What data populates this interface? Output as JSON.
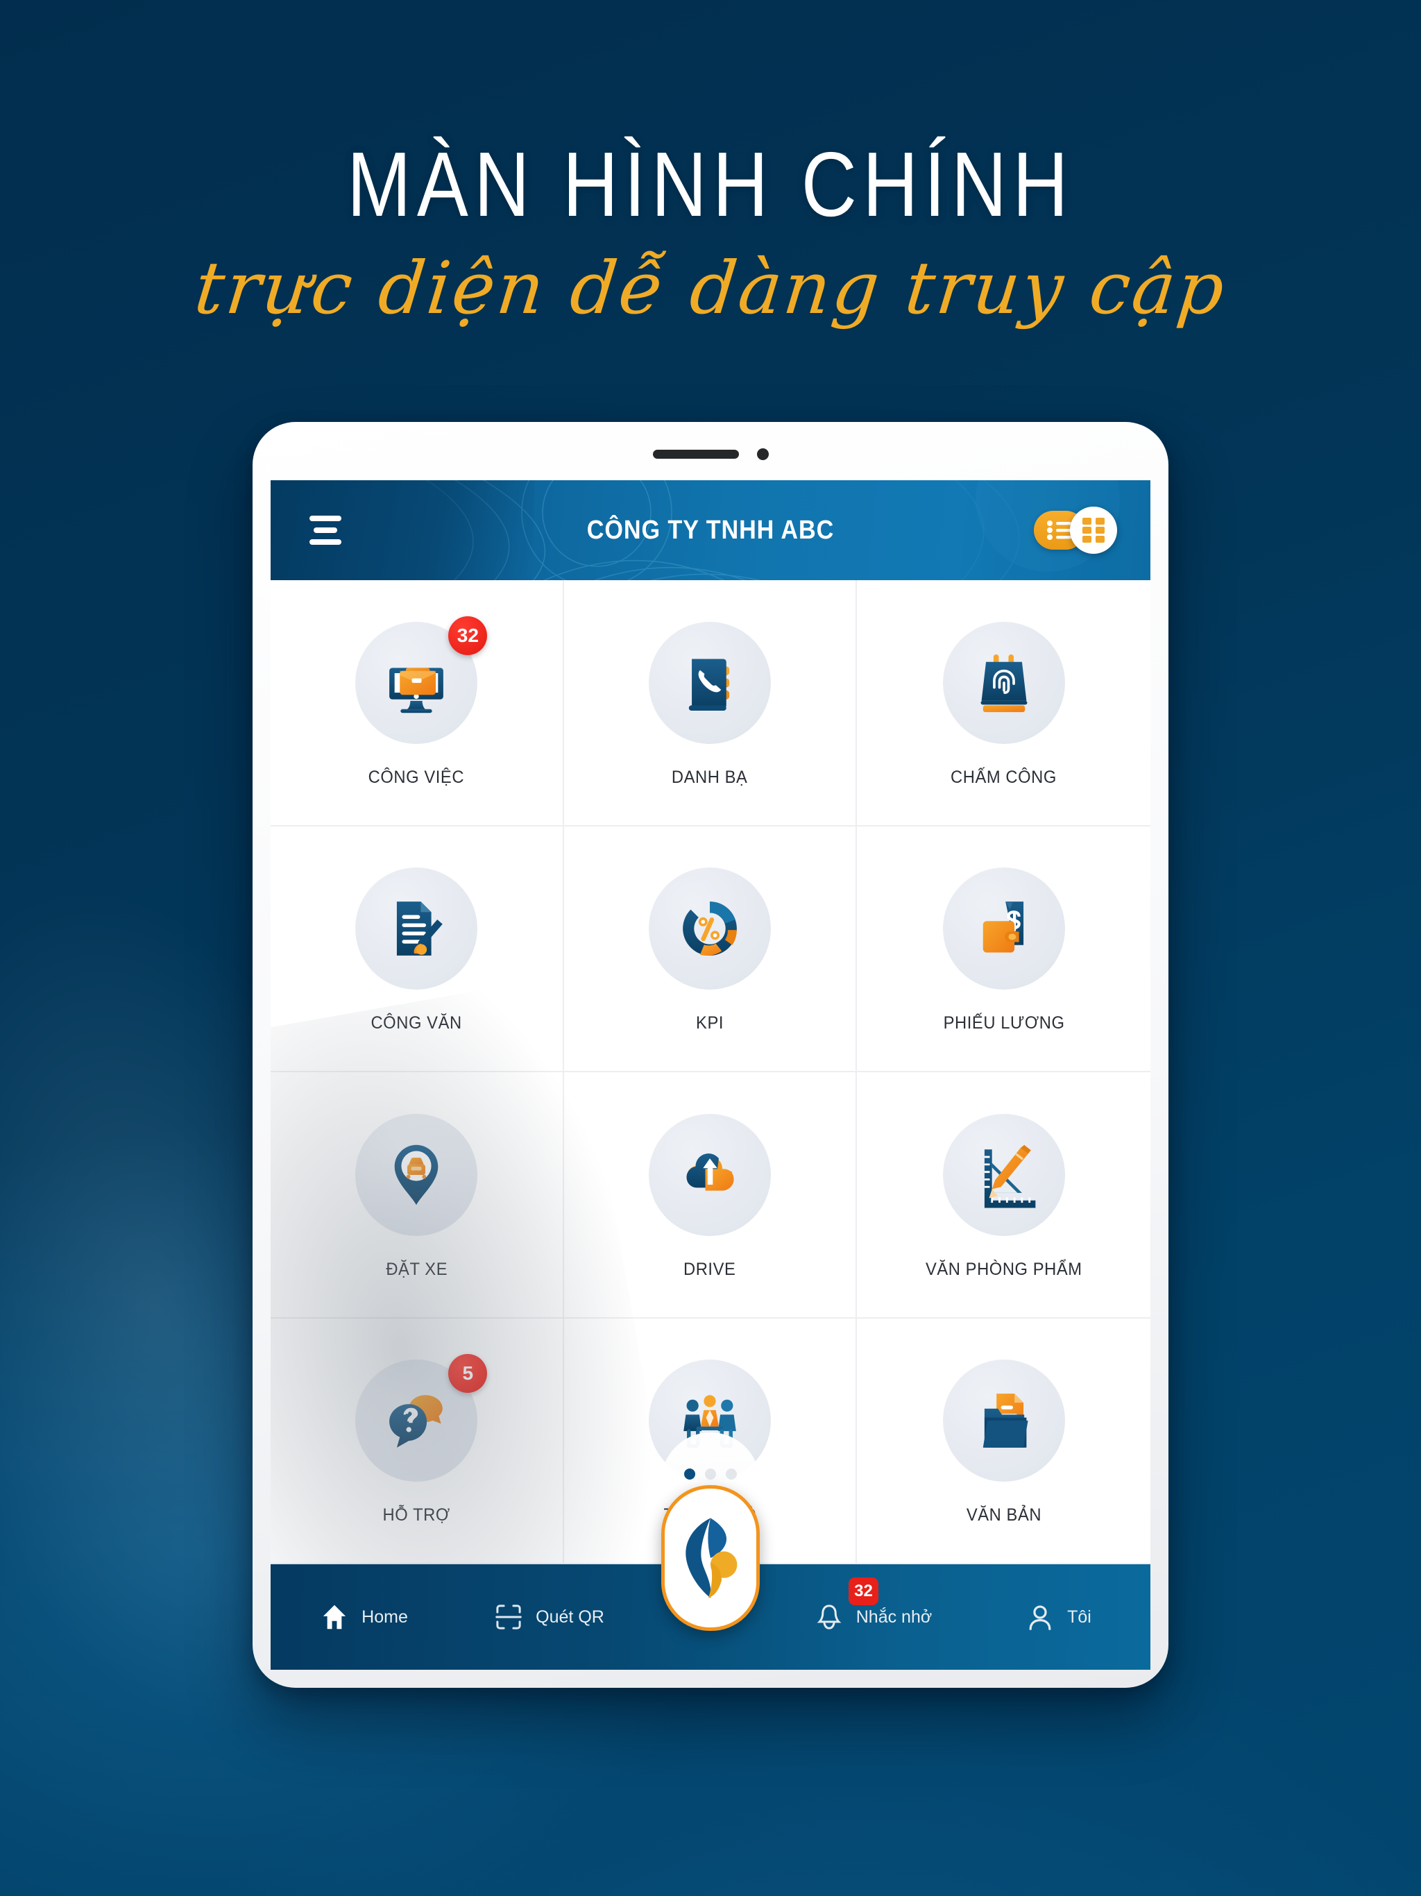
{
  "poster": {
    "title": "MÀN HÌNH CHÍNH",
    "subtitle": "trực diện dễ dàng truy cập",
    "bg_color": "#023153",
    "accent_color": "#f0ab26"
  },
  "app": {
    "header": {
      "title": "CÔNG TY TNHH ABC",
      "menu_icon": "hamburger-menu-icon",
      "view_toggle": {
        "list_icon": "list-view-icon",
        "grid_icon": "grid-view-icon",
        "selected": "grid"
      },
      "gradient_from": "#0a5f95",
      "gradient_to": "#1279b4"
    },
    "grid": {
      "columns": 3,
      "rows": 4,
      "tiles": [
        {
          "label": "CÔNG VIỆC",
          "icon": "monitor-briefcase-icon",
          "badge": "32"
        },
        {
          "label": "DANH BẠ",
          "icon": "phone-book-icon",
          "badge": ""
        },
        {
          "label": "CHẤM CÔNG",
          "icon": "fingerprint-calendar-icon",
          "badge": ""
        },
        {
          "label": "CÔNG VĂN",
          "icon": "document-pen-icon",
          "badge": ""
        },
        {
          "label": "KPI",
          "icon": "percent-donut-chart-icon",
          "badge": ""
        },
        {
          "label": "PHIẾU LƯƠNG",
          "icon": "wallet-dollar-icon",
          "badge": ""
        },
        {
          "label": "ĐẶT XE",
          "icon": "map-pin-car-icon",
          "badge": ""
        },
        {
          "label": "DRIVE",
          "icon": "cloud-upload-icon",
          "badge": ""
        },
        {
          "label": "VĂN PHÒNG PHẨM",
          "icon": "ruler-pencil-icon",
          "badge": ""
        },
        {
          "label": "HỖ TRỢ",
          "icon": "question-chat-icon",
          "badge": "5"
        },
        {
          "label": "TIN NỘI BỘ",
          "icon": "meeting-people-icon",
          "badge": ""
        },
        {
          "label": "VĂN BẢN",
          "icon": "folder-documents-icon",
          "badge": ""
        }
      ]
    },
    "page_indicator": {
      "total": 3,
      "active": 1
    },
    "bottom_nav": {
      "items": [
        {
          "label": "Home",
          "icon": "home-icon",
          "badge": ""
        },
        {
          "label": "Quét QR",
          "icon": "qr-scan-icon",
          "badge": ""
        },
        {
          "label": "Nhắc nhở",
          "icon": "bell-icon",
          "badge": "32"
        },
        {
          "label": "Tôi",
          "icon": "person-icon",
          "badge": ""
        }
      ],
      "center_button": {
        "icon": "app-logo-icon"
      },
      "gradient_from": "#053a61",
      "gradient_to": "#0b6a9d"
    }
  }
}
